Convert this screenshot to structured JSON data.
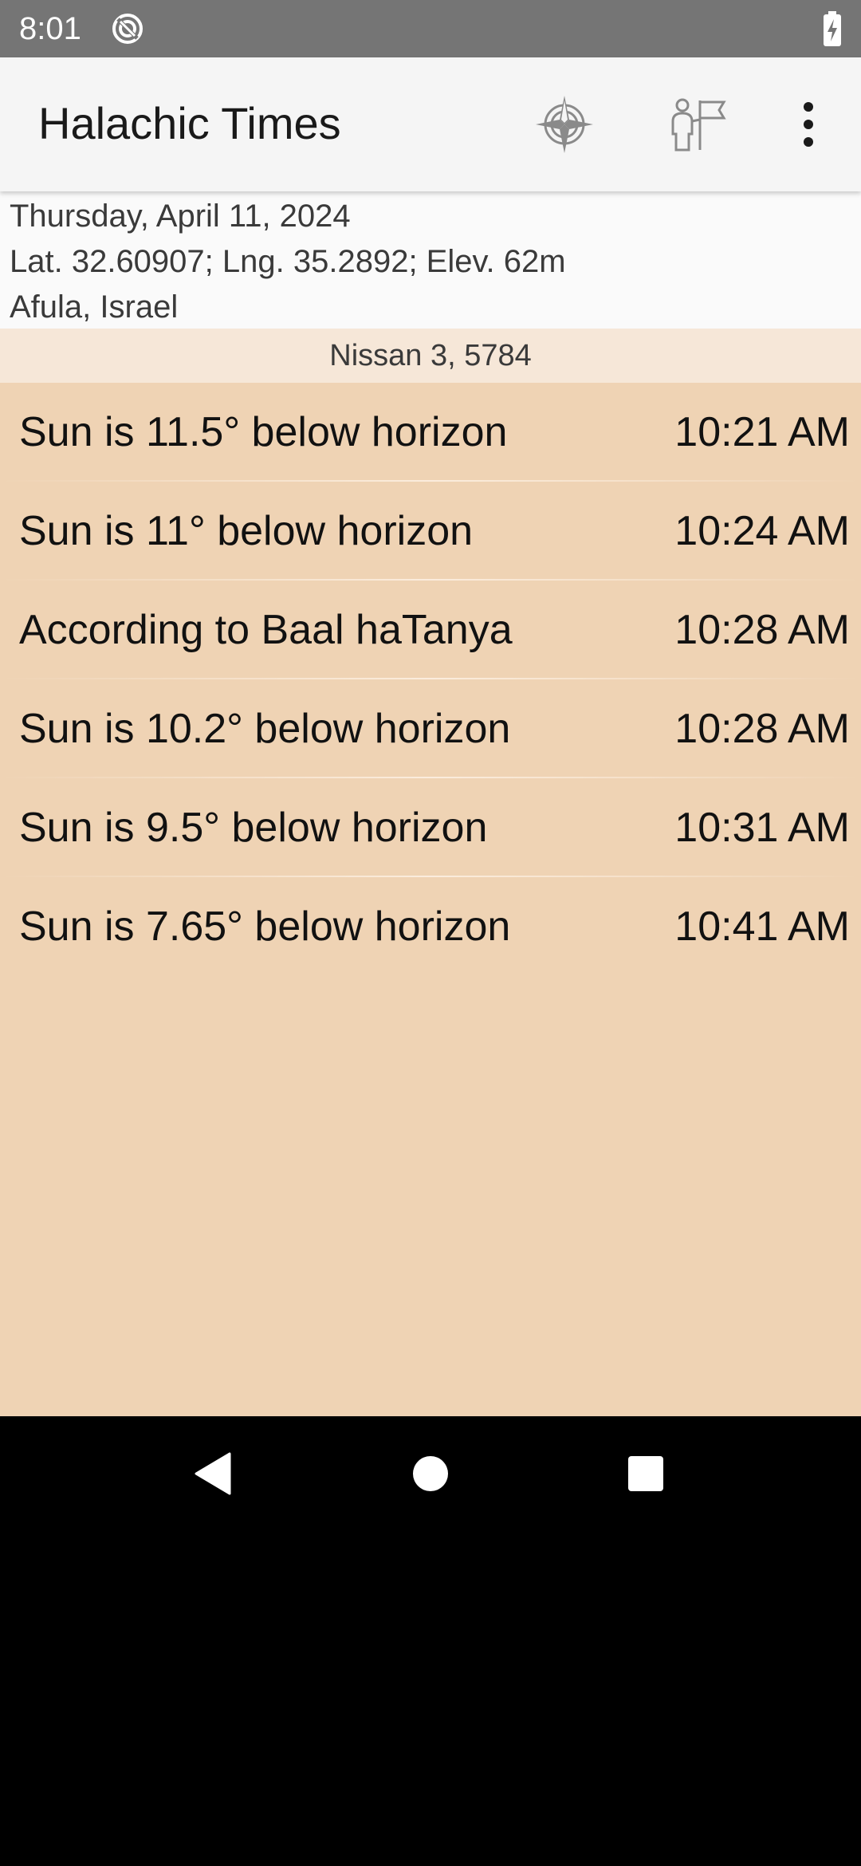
{
  "status_bar": {
    "time": "8:01",
    "icons": [
      "sync-icon",
      "battery-charging-icon"
    ]
  },
  "app_bar": {
    "title": "Halachic Times",
    "actions": [
      "location-icon",
      "guide-icon",
      "more-vert-icon"
    ]
  },
  "header": {
    "date": "Thursday, April 11, 2024",
    "coordinates": "Lat. 32.60907; Lng. 35.2892; Elev. 62m",
    "place": "Afula, Israel",
    "hebrew_date": "Nissan 3, 5784"
  },
  "times": [
    {
      "label": "Sun is 11.5° below horizon",
      "time": "10:21 AM"
    },
    {
      "label": "Sun is 11° below horizon",
      "time": "10:24 AM"
    },
    {
      "label": "According to Baal haTanya",
      "time": "10:28 AM"
    },
    {
      "label": "Sun is 10.2° below horizon",
      "time": "10:28 AM"
    },
    {
      "label": "Sun is 9.5° below horizon",
      "time": "10:31 AM"
    },
    {
      "label": "Sun is 7.65° below horizon",
      "time": "10:41 AM"
    }
  ],
  "nav_bar": {
    "buttons": [
      "back-icon",
      "home-icon",
      "recents-icon"
    ]
  },
  "colors": {
    "status_bar": "#757575",
    "app_bar": "#f5f5f5",
    "header": "#fafafa",
    "hebrew_date_bar": "#f6e7d8",
    "list_background": "#efd3b4",
    "nav_bar": "#000000"
  }
}
